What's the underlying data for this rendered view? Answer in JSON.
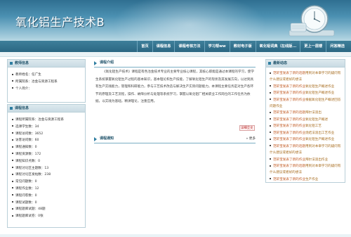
{
  "header": {
    "title": "氧化铝生产技术B"
  },
  "nav": {
    "items": [
      "首页",
      "课程信息",
      "课程考核方法",
      "学习帮ww",
      "教材电子版",
      "氧化铝词典（在线版...",
      "更上一层楼",
      "问答精选"
    ]
  },
  "teacher_panel": {
    "title": "教师信息",
    "items": [
      "教师姓名：任广生",
      "所属院系：冶金与资源工程系",
      "个人简介："
    ]
  },
  "course_panel": {
    "title": "课程信息",
    "items": [
      "课程所属院系：冶金与资源工程系",
      "选课学生数：34",
      "课程访问数：3652",
      "访客访问数：60",
      "课程通知数：0",
      "课程资源数：172",
      "课程知识点数：0",
      "课程讨论区主题数：13",
      "课程讨论区发帖数：238",
      "常见问题数：0",
      "课程作业数：12",
      "课程问卷数：0",
      "课程试题数：0",
      "课程题库试题：48题",
      "课程题库试卷：0张"
    ]
  },
  "intro_section": {
    "title": "课程介绍",
    "text": "《氧化铝生产技术》课程是有色冶金技术专业的主要专业核心课程，其核心职能是通过本课程的学习，使学生系统掌握氧化铝生产过程的基本知识，基本理论和生产技能，了解氧化铝生产的现状及其发展方向，以达到具有生产实践能力，管理和科研能力，参与工艺技术改造与解决生产实际问题能力。本课程主要任务是对生产各环节的原理及工艺流程，操作、故障分析与处理等系统学习，掌握以氧化铝厂相关职业工作岗位的工作任务为依据，以实践为基础，精讲理论，注重应用。",
    "detail_link": "详细全文"
  },
  "notice_section": {
    "title": "课程通知",
    "more": "更多"
  },
  "news_panel": {
    "title": "最新动态",
    "items": [
      {
        "who": "范轩宝发表了新的话题",
        "txt": "用到对本章学习的疑问有什么建议或者好的想法"
      },
      {
        "who": "范轩宝发表了新的作业",
        "txt": "氧化铝生产概述作业"
      },
      {
        "who": "范轩宝发表了新的作业",
        "txt": "氧化铝生产概述作业"
      },
      {
        "who": "范轩宝发表了新的作业",
        "txt": "根据氧化铝生产概述回答问题作业"
      },
      {
        "who": "范轩宝发表了新的话题",
        "txt": "拜尔法溶出"
      },
      {
        "who": "范轩宝发表了新的作业",
        "txt": "氧化铝生产概述"
      },
      {
        "who": "范轩宝发表了新的作业",
        "txt": "氧化铝工艺"
      },
      {
        "who": "范轩宝发表了新的作业",
        "txt": "烧结法溶出工艺作业"
      },
      {
        "who": "范轩宝发表了新的作业",
        "txt": "氧化铝生产概述作业"
      },
      {
        "who": "范轩宝发表了新的话题",
        "txt": "用到对本章学习的疑问有什么建议或者好的想法"
      },
      {
        "who": "范轩宝发表了新的作业",
        "txt": "拜尔法溶出作业"
      },
      {
        "who": "范轩宝发表了新的话题",
        "txt": "用到对本章学习的疑问有什么建议或者好的想法"
      },
      {
        "who": "范轩宝发表了新的作业",
        "txt": "生产作业"
      }
    ]
  }
}
